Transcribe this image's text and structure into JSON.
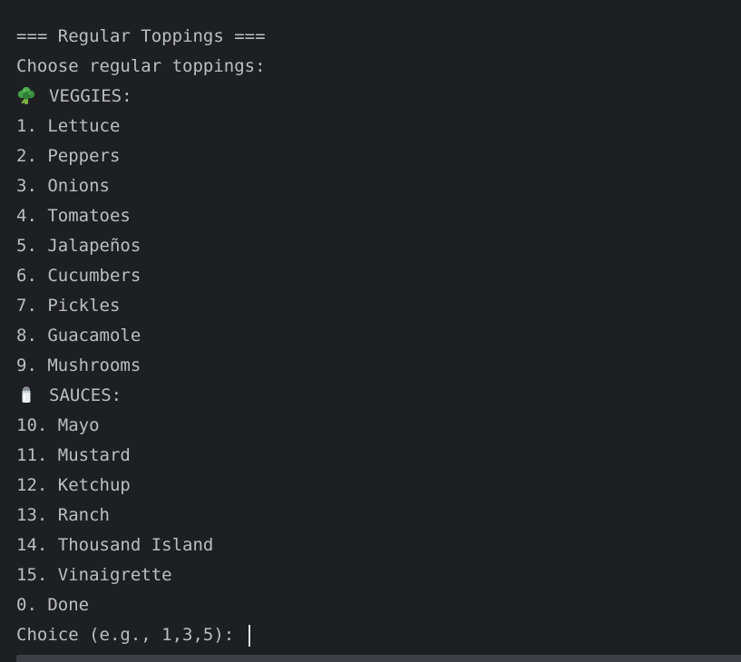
{
  "header": "=== Regular Toppings ===",
  "subheader": "Choose regular toppings:",
  "veggies": {
    "icon": "broccoli-icon",
    "label": "VEGGIES:",
    "items": [
      "1. Lettuce",
      "2. Peppers",
      "3. Onions",
      "4. Tomatoes",
      "5. Jalapeños",
      "6. Cucumbers",
      "7. Pickles",
      "8. Guacamole",
      "9. Mushrooms"
    ]
  },
  "sauces": {
    "icon": "salt-shaker-icon",
    "label": "SAUCES:",
    "items": [
      "10. Mayo",
      "11. Mustard",
      "12. Ketchup",
      "13. Ranch",
      "14. Thousand Island",
      "15. Vinaigrette"
    ]
  },
  "done": "0. Done",
  "prompt": "Choice (e.g., 1,3,5): ",
  "colors": {
    "background": "#1e1f22",
    "text": "#bcbec4",
    "caret": "#dfe1e5",
    "scrollbar": "#3c3f44"
  }
}
